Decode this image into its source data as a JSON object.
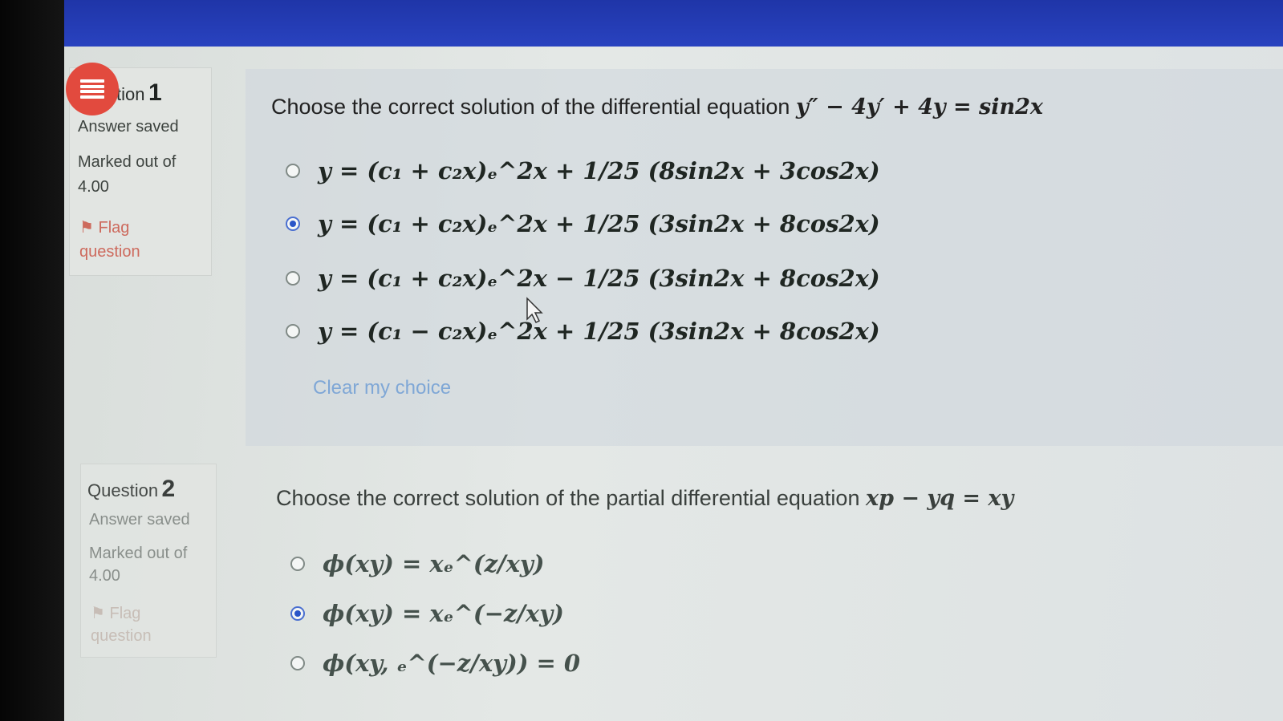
{
  "q1": {
    "title": "tion",
    "number": "1",
    "status": "Answer saved",
    "marked_label": "Marked out of",
    "marked_value": "4.00",
    "flag_label": "Flag question",
    "text": "Choose the correct solution of the differential equation",
    "equation": "y″ − 4y′ + 4y = sin2x",
    "options": [
      {
        "text": "y = (c₁ + c₂x)ₑ^2x + 1/25 (8sin2x + 3cos2x)",
        "selected": false
      },
      {
        "text": "y = (c₁ + c₂x)ₑ^2x + 1/25 (3sin2x + 8cos2x)",
        "selected": true
      },
      {
        "text": "y = (c₁ + c₂x)ₑ^2x − 1/25 (3sin2x + 8cos2x)",
        "selected": false
      },
      {
        "text": "y = (c₁ − c₂x)ₑ^2x + 1/25 (3sin2x + 8cos2x)",
        "selected": false
      }
    ],
    "clear_label": "Clear my choice"
  },
  "q2": {
    "title": "Question",
    "number": "2",
    "status": "Answer saved",
    "marked_label": "Marked out of",
    "marked_value": "4.00",
    "flag_label": "Flag question",
    "text": "Choose the correct solution of the partial differential equation",
    "equation": "xp − yq = xy",
    "options": [
      {
        "text": "ϕ(xy) = xₑ^(z/xy)",
        "selected": false
      },
      {
        "text": "ϕ(xy) = xₑ^(−z/xy)",
        "selected": true
      },
      {
        "text": "ϕ(xy, ₑ^(−z/xy)) = 0",
        "selected": false
      }
    ]
  },
  "icons": {
    "nav": "question-list-icon",
    "flag": "flag-icon",
    "cursor": "mouse-pointer-icon"
  },
  "colors": {
    "topbar": "#2a44c2",
    "nav_button": "#e24a3e",
    "radio_selected": "#2a55c8",
    "flag": "#cd6a5d",
    "link": "#7fa7d6"
  }
}
